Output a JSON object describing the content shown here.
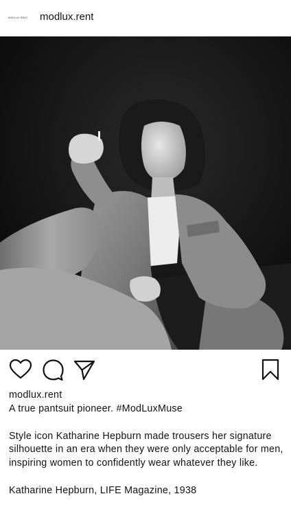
{
  "header": {
    "avatar_text": "MODLUX.RENT",
    "username": "modlux.rent"
  },
  "photo": {
    "alt": "Katharine Hepburn in a pantsuit"
  },
  "icons": {
    "like": "heart-icon",
    "comment": "comment-bubble-icon",
    "share": "paper-plane-icon",
    "save": "bookmark-icon"
  },
  "caption": {
    "account": "modlux.rent",
    "headline": "A true pantsuit pioneer. #ModLuxMuse",
    "body": "Style icon Katharine Hepburn made trousers her signature silhouette in an era when they were only acceptable for men, inspiring women to confidently wear whatever they like.",
    "credit": "Katharine Hepburn, LIFE Magazine, 1938"
  },
  "colors": {
    "icon_stroke": "#111111",
    "background": "#ffffff"
  }
}
